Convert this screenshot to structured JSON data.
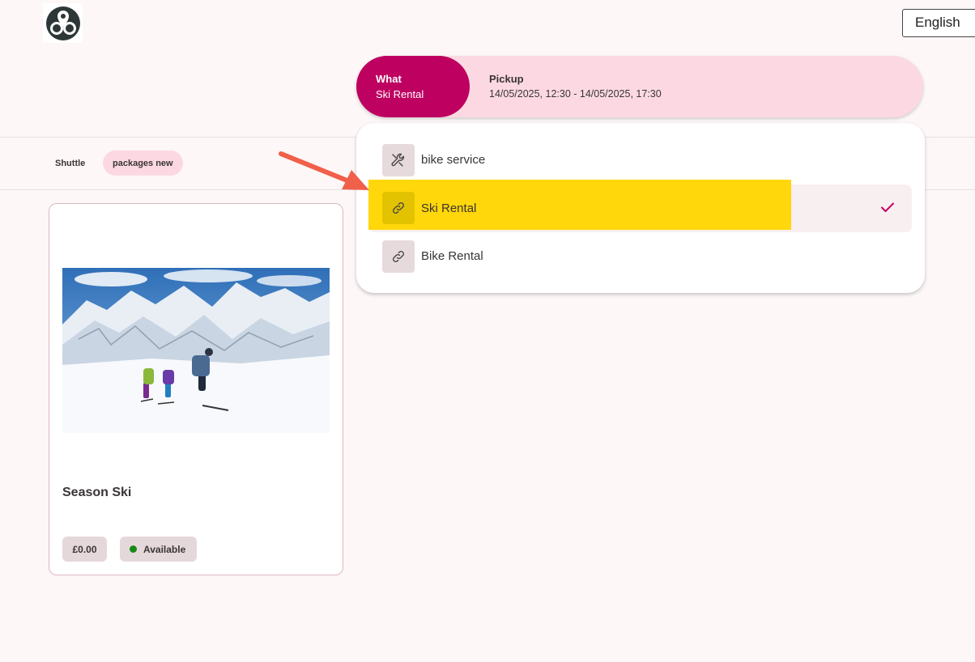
{
  "header": {
    "logo_icon": "map-pin-logo-icon",
    "language": "English"
  },
  "search": {
    "what_title": "What",
    "what_value": "Ski Rental",
    "pickup_title": "Pickup",
    "pickup_value": "14/05/2025, 12:30 - 14/05/2025, 17:30"
  },
  "filters": {
    "chips": [
      "Shuttle",
      "packages new"
    ],
    "active_chip": "packages new"
  },
  "card": {
    "title": "Season Ski",
    "price": "£0.00",
    "status": "Available",
    "status_color": "#168a16",
    "image": "ski-mountain-photo"
  },
  "dropdown": {
    "items": [
      {
        "label": "bike service",
        "icon": "wrench-icon"
      },
      {
        "label": "Ski Rental",
        "icon": "link-icon",
        "selected": true
      },
      {
        "label": "Bike Rental",
        "icon": "link-icon"
      }
    ],
    "selected_icon": "checkmark-icon"
  },
  "colors": {
    "accent": "#be0060",
    "pill_bg": "#fcd9e2",
    "highlight": "#ffd500",
    "arrow": "#f0604a"
  }
}
